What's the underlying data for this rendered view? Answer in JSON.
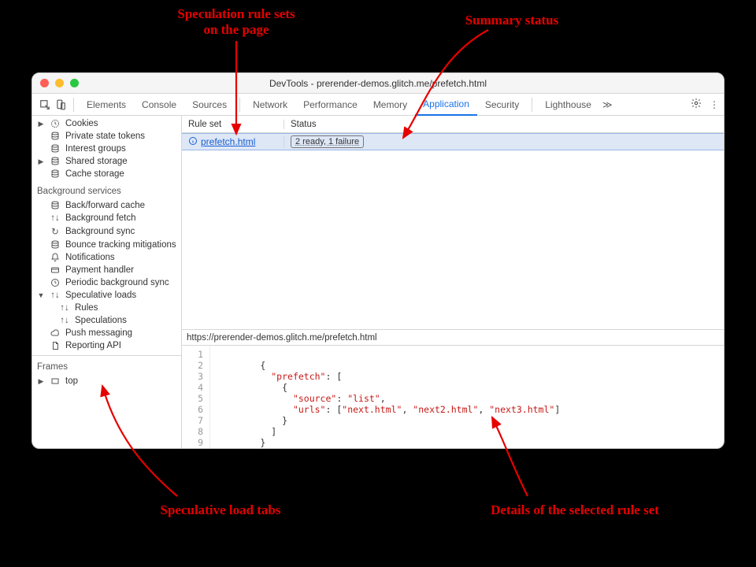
{
  "window": {
    "title": "DevTools - prerender-demos.glitch.me/prefetch.html"
  },
  "tabs": {
    "items": [
      "Elements",
      "Console",
      "Sources",
      "Network",
      "Performance",
      "Memory",
      "Application",
      "Security",
      "Lighthouse"
    ],
    "selected": "Application",
    "overflow": "≫"
  },
  "sidebar": {
    "app_items": [
      {
        "icon": "clock",
        "label": "Cookies",
        "caret": true
      },
      {
        "icon": "db",
        "label": "Private state tokens",
        "caret": false
      },
      {
        "icon": "db",
        "label": "Interest groups",
        "caret": false
      },
      {
        "icon": "db",
        "label": "Shared storage",
        "caret": true
      },
      {
        "icon": "db",
        "label": "Cache storage",
        "caret": false
      }
    ],
    "bg_heading": "Background services",
    "bg_items": [
      {
        "icon": "db",
        "label": "Back/forward cache"
      },
      {
        "icon": "updown",
        "label": "Background fetch"
      },
      {
        "icon": "sync",
        "label": "Background sync"
      },
      {
        "icon": "db",
        "label": "Bounce tracking mitigations"
      },
      {
        "icon": "bell",
        "label": "Notifications"
      },
      {
        "icon": "card",
        "label": "Payment handler"
      },
      {
        "icon": "clock",
        "label": "Periodic background sync"
      }
    ],
    "spec": {
      "label": "Speculative loads",
      "children": [
        {
          "icon": "updown",
          "label": "Rules"
        },
        {
          "icon": "updown",
          "label": "Speculations"
        }
      ]
    },
    "rest": [
      {
        "icon": "cloud",
        "label": "Push messaging"
      },
      {
        "icon": "doc",
        "label": "Reporting API"
      }
    ],
    "frames_heading": "Frames",
    "frames_item": "top"
  },
  "ruleset_table": {
    "headers": {
      "ruleset": "Rule set",
      "status": "Status"
    },
    "row": {
      "ruleset": "prefetch.html",
      "status": "2 ready, 1 failure"
    }
  },
  "url": "https://prerender-demos.glitch.me/prefetch.html",
  "code": {
    "lines": [
      "",
      "{",
      "  \"prefetch\": [",
      "    {",
      "      \"source\": \"list\",",
      "      \"urls\": [\"next.html\", \"next2.html\", \"next3.html\"]",
      "    }",
      "  ]",
      "}"
    ]
  },
  "annotations": {
    "rulesets": "Speculation rule sets\non the page",
    "summary": "Summary status",
    "tabs": "Speculative load tabs",
    "details": "Details of the selected rule set"
  }
}
